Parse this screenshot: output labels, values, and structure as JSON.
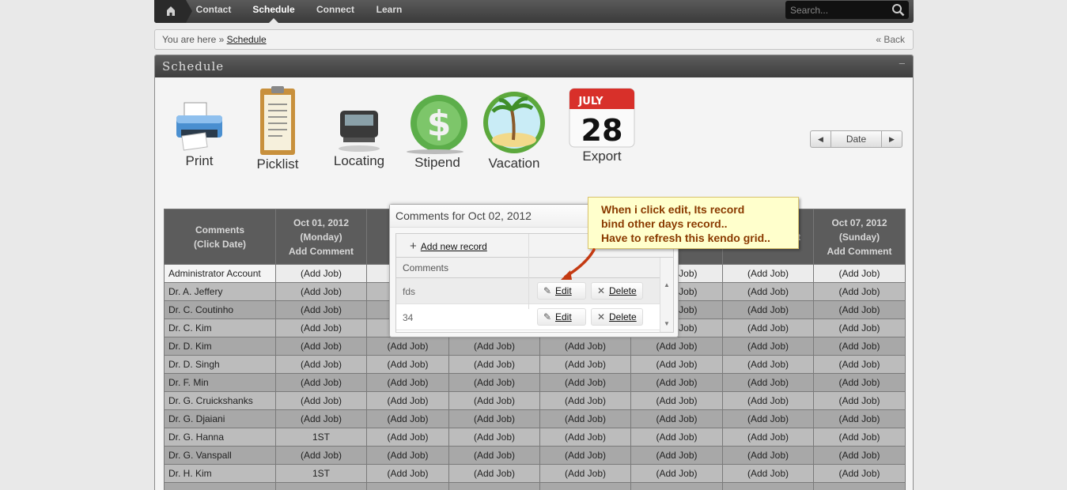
{
  "nav": {
    "items": [
      {
        "label": "Contact"
      },
      {
        "label": "Schedule"
      },
      {
        "label": "Connect"
      },
      {
        "label": "Learn"
      }
    ],
    "search_placeholder": "Search..."
  },
  "breadcrumb": {
    "prefix": "You are here »",
    "current": "Schedule",
    "back": "« Back"
  },
  "panel": {
    "title": "Schedule",
    "collapse": "–"
  },
  "toolbar": {
    "print": "Print",
    "picklist": "Picklist",
    "locating": "Locating",
    "stipend": "Stipend",
    "vacation": "Vacation",
    "export": "Export",
    "calendar_month": "JULY",
    "calendar_day": "28"
  },
  "pager": {
    "prev": "◀",
    "label": "Date",
    "next": "▶"
  },
  "grid": {
    "headers": [
      {
        "l1": "Comments",
        "l2": "(Click Date)",
        "l3": ""
      },
      {
        "l1": "Oct 01, 2012",
        "l2": "(Monday)",
        "l3": "Add Comment"
      },
      {
        "l1": "Oc",
        "l2": "(",
        "l3": "2"
      },
      {
        "l1": "",
        "l2": "",
        "l3": ""
      },
      {
        "l1": "",
        "l2": "",
        "l3": ""
      },
      {
        "l1": "",
        "l2": "",
        "l3": "mment"
      },
      {
        "l1": "",
        "l2": "",
        "l3": "Add Comment"
      },
      {
        "l1": "Oct 07, 2012",
        "l2": "(Sunday)",
        "l3": "Add Comment"
      }
    ],
    "rows": [
      {
        "name": "Administrator Account",
        "c1": "(Add Job)",
        "c2": "",
        "c3": "",
        "c4": "",
        "c5": "(Add Job)",
        "c6": "(Add Job)",
        "c7": "(Add Job)"
      },
      {
        "name": "Dr. A. Jeffery",
        "c1": "(Add Job)",
        "c2": "",
        "c3": "",
        "c4": "",
        "c5": "(Add Job)",
        "c6": "(Add Job)",
        "c7": "(Add Job)"
      },
      {
        "name": "Dr. C. Coutinho",
        "c1": "(Add Job)",
        "c2": "",
        "c3": "",
        "c4": "",
        "c5": "(Add Job)",
        "c6": "(Add Job)",
        "c7": "(Add Job)"
      },
      {
        "name": "Dr. C. Kim",
        "c1": "(Add Job)",
        "c2": "",
        "c3": "",
        "c4": "",
        "c5": "(Add Job)",
        "c6": "(Add Job)",
        "c7": "(Add Job)"
      },
      {
        "name": "Dr. D. Kim",
        "c1": "(Add Job)",
        "c2": "(Add Job)",
        "c3": "(Add Job)",
        "c4": "(Add Job)",
        "c5": "(Add Job)",
        "c6": "(Add Job)",
        "c7": "(Add Job)"
      },
      {
        "name": "Dr. D. Singh",
        "c1": "(Add Job)",
        "c2": "(Add Job)",
        "c3": "(Add Job)",
        "c4": "(Add Job)",
        "c5": "(Add Job)",
        "c6": "(Add Job)",
        "c7": "(Add Job)"
      },
      {
        "name": "Dr. F. Min",
        "c1": "(Add Job)",
        "c2": "(Add Job)",
        "c3": "(Add Job)",
        "c4": "(Add Job)",
        "c5": "(Add Job)",
        "c6": "(Add Job)",
        "c7": "(Add Job)"
      },
      {
        "name": "Dr. G. Cruickshanks",
        "c1": "(Add Job)",
        "c2": "(Add Job)",
        "c3": "(Add Job)",
        "c4": "(Add Job)",
        "c5": "(Add Job)",
        "c6": "(Add Job)",
        "c7": "(Add Job)"
      },
      {
        "name": "Dr. G. Djaiani",
        "c1": "(Add Job)",
        "c2": "(Add Job)",
        "c3": "(Add Job)",
        "c4": "(Add Job)",
        "c5": "(Add Job)",
        "c6": "(Add Job)",
        "c7": "(Add Job)"
      },
      {
        "name": "Dr. G. Hanna",
        "c1": "1ST",
        "c2": "(Add Job)",
        "c3": "(Add Job)",
        "c4": "(Add Job)",
        "c5": "(Add Job)",
        "c6": "(Add Job)",
        "c7": "(Add Job)"
      },
      {
        "name": "Dr. G. Vanspall",
        "c1": "(Add Job)",
        "c2": "(Add Job)",
        "c3": "(Add Job)",
        "c4": "(Add Job)",
        "c5": "(Add Job)",
        "c6": "(Add Job)",
        "c7": "(Add Job)"
      },
      {
        "name": "Dr. H. Kim",
        "c1": "1ST",
        "c2": "(Add Job)",
        "c3": "(Add Job)",
        "c4": "(Add Job)",
        "c5": "(Add Job)",
        "c6": "(Add Job)",
        "c7": "(Add Job)"
      },
      {
        "name": "",
        "c1": "",
        "c2": "",
        "c3": "",
        "c4": "",
        "c5": "",
        "c6": "",
        "c7": ""
      }
    ]
  },
  "popup": {
    "title": "Comments for Oct 02, 2012",
    "add_record": "Add new record",
    "column": "Comments",
    "rows": [
      {
        "value": "fds",
        "edit": "Edit",
        "delete": "Delete"
      },
      {
        "value": "34",
        "edit": "Edit",
        "delete": "Delete"
      }
    ]
  },
  "callout": {
    "line1": "When i click edit, Its record",
    "line2": "bind other days record..",
    "line3": "Have to refresh this kendo grid.."
  }
}
